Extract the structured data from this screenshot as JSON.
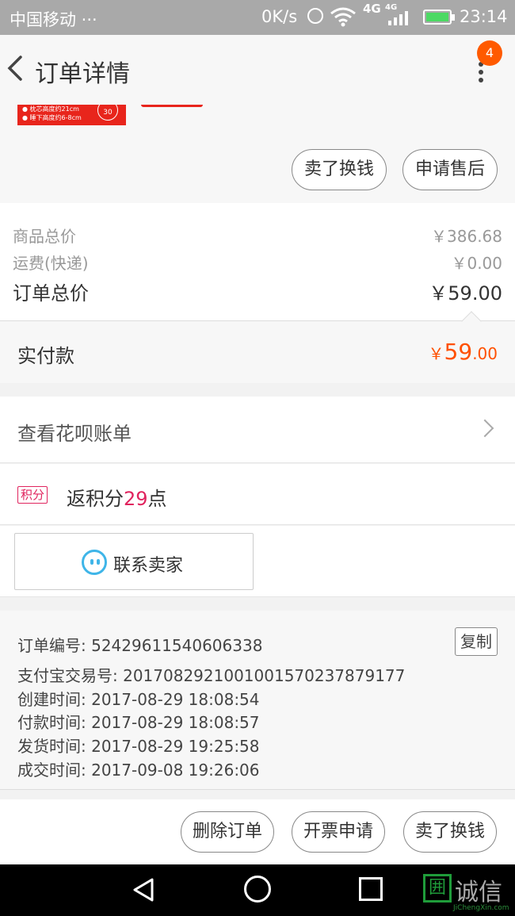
{
  "status_bar": {
    "carrier": "中国移动 ···",
    "speed": "0K/s",
    "network": "4G",
    "network_small": "4G",
    "time": "23:14"
  },
  "header": {
    "title": "订单详情",
    "badge": "4"
  },
  "product": {
    "thumb_line1": "● 枕芯高度约21cm",
    "thumb_line2": "● 睡下高度约6-8cm",
    "thumb_badge": "30"
  },
  "product_actions": {
    "sell_label": "卖了换钱",
    "after_sale_label": "申请售后"
  },
  "prices": {
    "goods_total_label": "商品总价",
    "goods_total_value": "￥386.68",
    "shipping_label": "运费(快递)",
    "shipping_value": "￥0.00",
    "order_total_label": "订单总价",
    "order_total_value": "￥59.00"
  },
  "paid": {
    "label": "实付款",
    "currency": "￥",
    "integer": "59",
    "decimal": ".00"
  },
  "huabei": {
    "label": "查看花呗账单"
  },
  "points": {
    "tag": "积分",
    "prefix": "返积分",
    "value": "29",
    "suffix": "点"
  },
  "contact": {
    "label": "联系卖家"
  },
  "order_info": {
    "copy_label": "复制",
    "lines": [
      "订单编号: 52429611540606338",
      "支付宝交易号: 2017082921001001570237879177",
      "创建时间: 2017-08-29 18:08:54",
      "付款时间: 2017-08-29 18:08:57",
      "发货时间: 2017-08-29 19:25:58",
      "成交时间: 2017-09-08 19:26:06"
    ]
  },
  "bottom_actions": {
    "delete_label": "删除订单",
    "invoice_label": "开票申请",
    "sell_label": "卖了换钱"
  },
  "watermark": {
    "logo": "囲",
    "name": "诚信",
    "sub": "JiChengXin.com"
  },
  "colors": {
    "accent": "#ff5000",
    "points": "#e0245e",
    "badge": "#ff5a00"
  }
}
